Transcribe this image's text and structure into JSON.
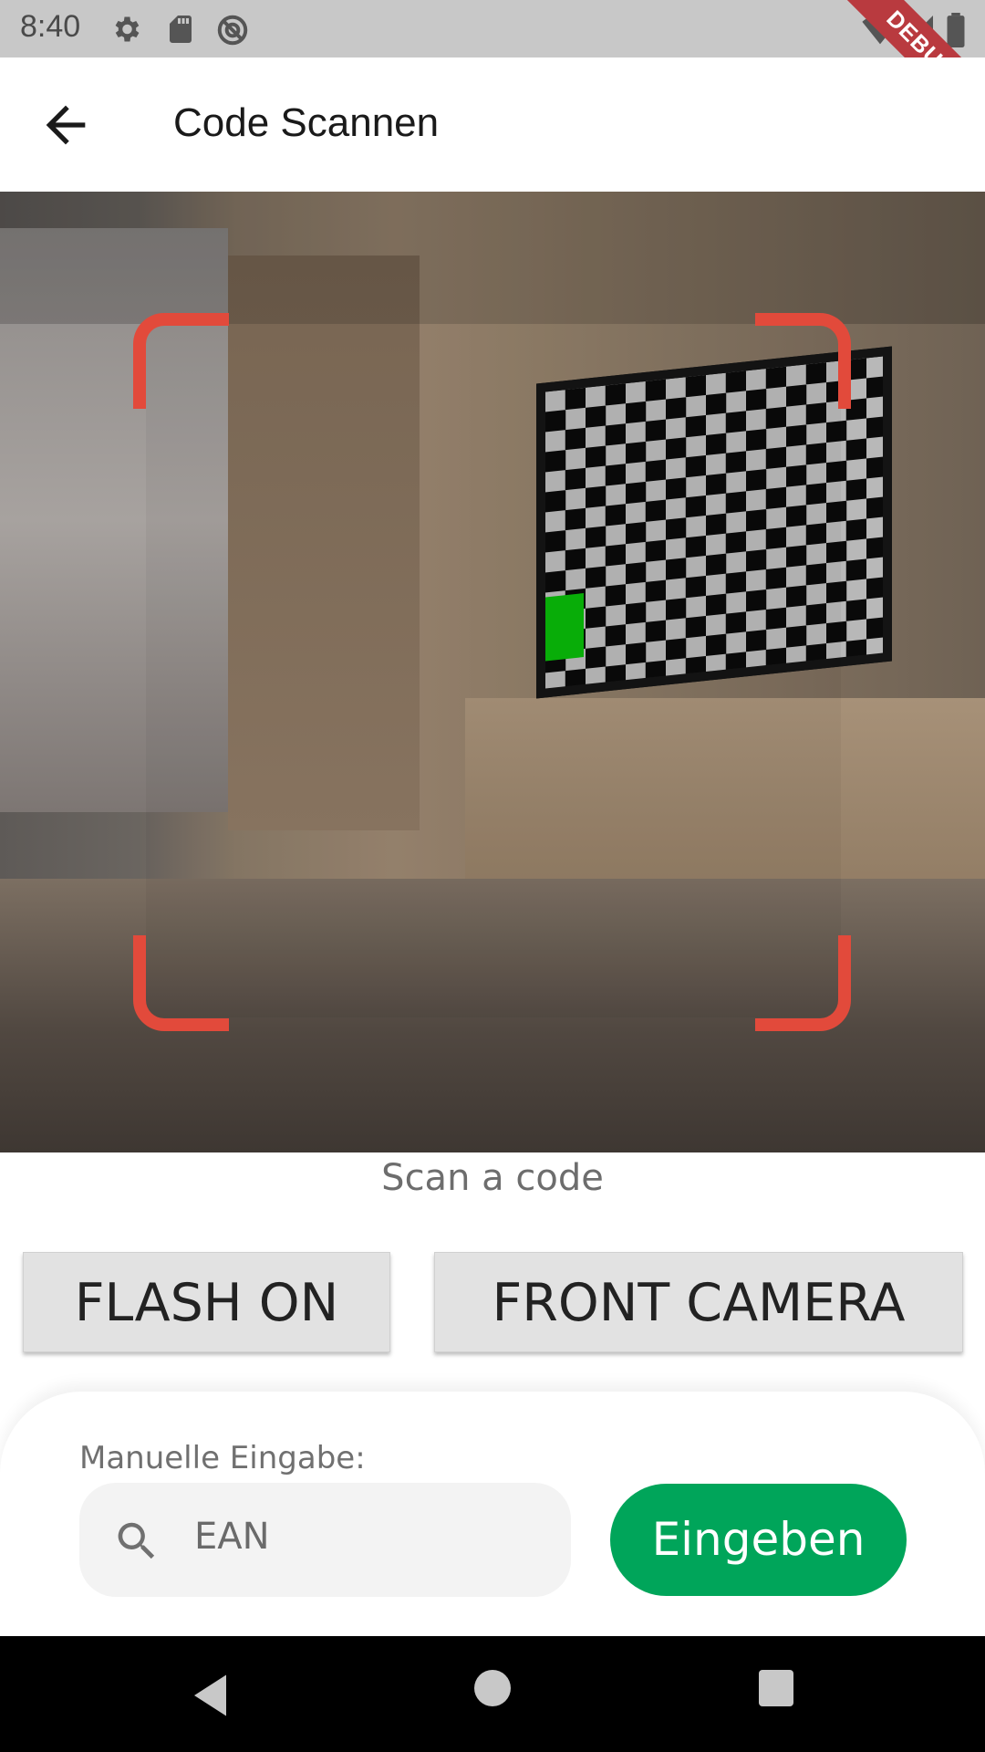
{
  "status_bar": {
    "time": "8:40",
    "icons": [
      "settings-icon",
      "sd-card-icon",
      "vpn-icon",
      "wifi-icon",
      "signal-icon",
      "battery-icon"
    ],
    "debug_banner": "DEBUG"
  },
  "app_bar": {
    "title": "Code Scannen",
    "back_icon": "arrow-back-icon"
  },
  "scanner": {
    "caption": "Scan a code",
    "frame_color": "#e24a3b"
  },
  "controls": {
    "flash_label": "FLASH ON",
    "camera_label": "FRONT CAMERA"
  },
  "manual_entry": {
    "label": "Manuelle Eingabe:",
    "placeholder": "EAN",
    "submit_label": "Eingeben",
    "submit_color": "#00a55a"
  },
  "nav_bar": {
    "icons": [
      "nav-back-icon",
      "nav-home-icon",
      "nav-recents-icon"
    ]
  }
}
